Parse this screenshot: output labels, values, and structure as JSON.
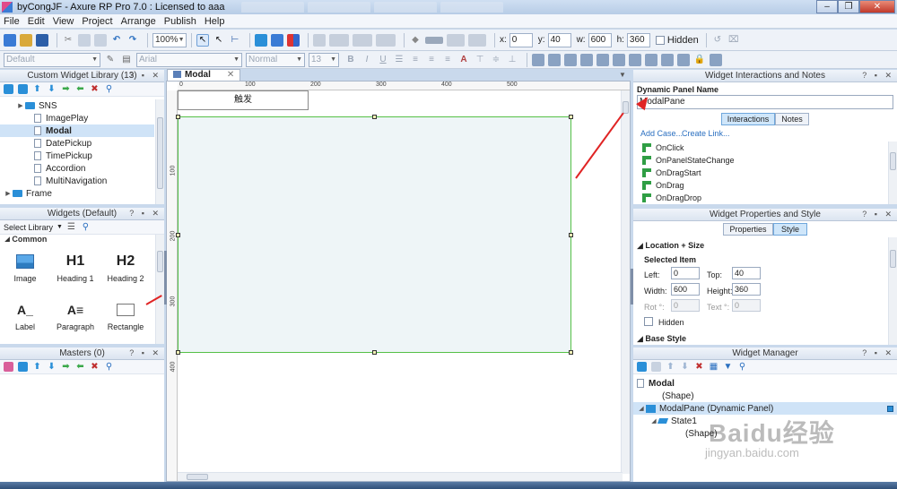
{
  "window": {
    "title": "byCongJF - Axure RP Pro 7.0 : Licensed to aaa",
    "minimize": "–",
    "maximize": "❐",
    "close": "✕"
  },
  "menu": [
    "File",
    "Edit",
    "View",
    "Project",
    "Arrange",
    "Publish",
    "Help"
  ],
  "toolbar": {
    "zoom": "100%",
    "x_label": "x:",
    "x_value": "0",
    "y_label": "y:",
    "y_value": "40",
    "w_label": "w:",
    "w_value": "600",
    "h_label": "h:",
    "h_value": "360",
    "hidden_label": "Hidden",
    "style_combo": "Default",
    "font_combo": "Arial",
    "weight_combo": "Normal",
    "size_combo": "13",
    "bold": "B",
    "italic": "I",
    "underline": "U",
    "font_color": "A"
  },
  "custom_library": {
    "title": "Custom Widget Library (13)",
    "items": [
      {
        "label": "SNS",
        "type": "folder",
        "depth": 1,
        "selected": false
      },
      {
        "label": "ImagePlay",
        "type": "page",
        "depth": 2,
        "selected": false
      },
      {
        "label": "Modal",
        "type": "page",
        "depth": 2,
        "selected": true
      },
      {
        "label": "DatePickup",
        "type": "page",
        "depth": 2,
        "selected": false
      },
      {
        "label": "TimePickup",
        "type": "page",
        "depth": 2,
        "selected": false
      },
      {
        "label": "Accordion",
        "type": "page",
        "depth": 2,
        "selected": false
      },
      {
        "label": "MultiNavigation",
        "type": "page",
        "depth": 2,
        "selected": false
      },
      {
        "label": "Frame",
        "type": "folder",
        "depth": 0,
        "selected": false
      }
    ]
  },
  "widgets": {
    "title": "Widgets (Default)",
    "select_library": "Select Library",
    "section": "Common",
    "items": [
      {
        "label": "Image",
        "glyph": "image-icon"
      },
      {
        "label": "Heading 1",
        "glyph": "H1"
      },
      {
        "label": "Heading 2",
        "glyph": "H2"
      },
      {
        "label": "Label",
        "glyph": "A_"
      },
      {
        "label": "Paragraph",
        "glyph": "A≡"
      },
      {
        "label": "Rectangle",
        "glyph": "rect"
      }
    ]
  },
  "masters": {
    "title": "Masters (0)"
  },
  "document": {
    "tab": "Modal",
    "ruler_h": [
      "0",
      "100",
      "200",
      "300",
      "400",
      "500"
    ],
    "ruler_v": [
      "100",
      "200",
      "300",
      "400"
    ],
    "trigger_button": "触发"
  },
  "interactions": {
    "title": "Widget Interactions and Notes",
    "panel_name_label": "Dynamic Panel Name",
    "panel_name_value": "ModalPane",
    "tab_interactions": "Interactions",
    "tab_notes": "Notes",
    "add_case": "Add Case...",
    "create_link": "Create Link...",
    "events": [
      "OnClick",
      "OnPanelStateChange",
      "OnDragStart",
      "OnDrag",
      "OnDragDrop"
    ]
  },
  "properties": {
    "title": "Widget Properties and Style",
    "tab_properties": "Properties",
    "tab_style": "Style",
    "section_location": "Location + Size",
    "selected_item": "Selected Item",
    "left_label": "Left:",
    "left_value": "0",
    "top_label": "Top:",
    "top_value": "40",
    "width_label": "Width:",
    "width_value": "600",
    "height_label": "Height:",
    "height_value": "360",
    "rot_label": "Rot °:",
    "rot_value": "0",
    "text_label": "Text °:",
    "text_value": "0",
    "hidden_label": "Hidden",
    "section_base": "Base Style"
  },
  "widget_manager": {
    "title": "Widget Manager",
    "rows": [
      {
        "label": "Modal",
        "bold": true
      },
      {
        "label": "(Shape)",
        "bold": false
      },
      {
        "label": "ModalPane (Dynamic Panel)",
        "bold": false
      },
      {
        "label": "State1",
        "bold": false
      },
      {
        "label": "(Shape)",
        "bold": false
      }
    ]
  },
  "watermark": {
    "main": "Baidu经验",
    "sub": "jingyan.baidu.com"
  },
  "colors": {
    "accent": "#2a8fd8",
    "selection": "#55c046",
    "arrow": "#e02424"
  }
}
